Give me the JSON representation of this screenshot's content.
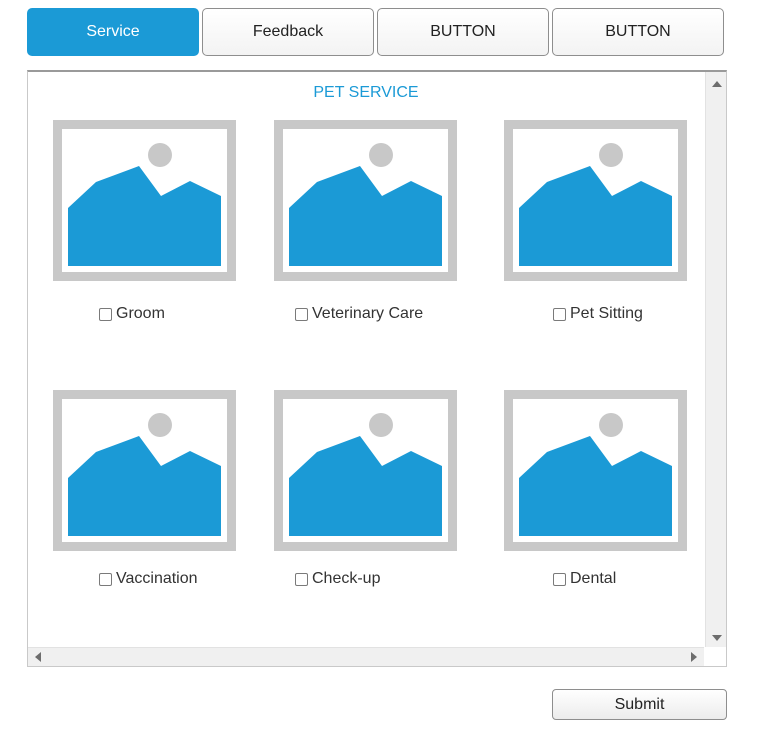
{
  "tabs": [
    {
      "label": "Service",
      "active": true
    },
    {
      "label": "Feedback",
      "active": false
    },
    {
      "label": "BUTTON",
      "active": false
    },
    {
      "label": "BUTTON",
      "active": false
    }
  ],
  "panel": {
    "title": "PET SERVICE",
    "options": [
      {
        "label": "Groom",
        "checked": false
      },
      {
        "label": "Veterinary Care",
        "checked": false
      },
      {
        "label": "Pet Sitting",
        "checked": false
      },
      {
        "label": "Vaccination",
        "checked": false
      },
      {
        "label": "Check-up",
        "checked": false
      },
      {
        "label": "Dental",
        "checked": false
      }
    ]
  },
  "actions": {
    "submit_label": "Submit"
  },
  "colors": {
    "accent": "#1b9ad6",
    "placeholder_frame": "#c8c8c8"
  },
  "icons": {
    "image_placeholder": "image-placeholder-icon"
  }
}
